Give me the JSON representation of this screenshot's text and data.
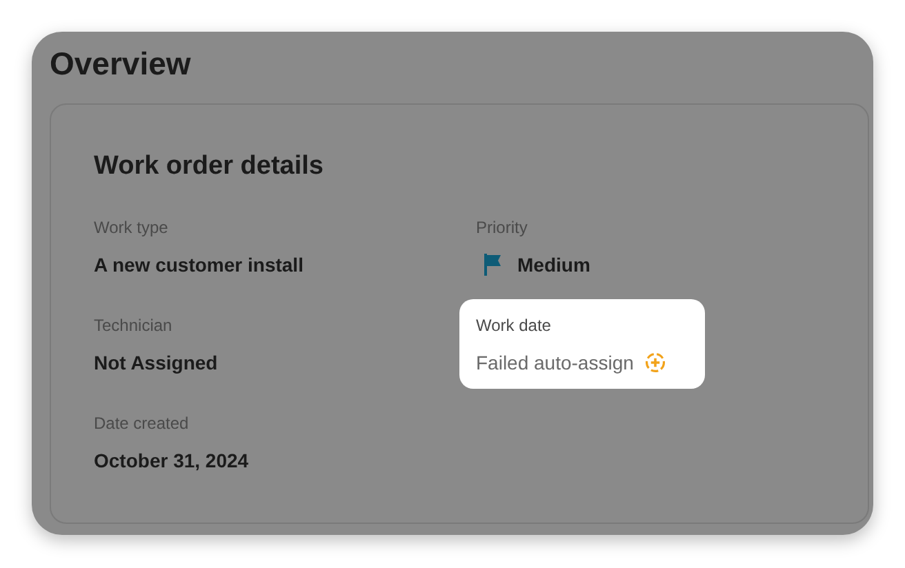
{
  "page": {
    "title": "Overview"
  },
  "card": {
    "title": "Work order details",
    "fields": [
      {
        "label": "Work type",
        "value": "A new customer install",
        "kind": "plain",
        "highlighted": false
      },
      {
        "label": "Priority",
        "value": "Medium",
        "kind": "flag",
        "highlighted": false
      },
      {
        "label": "Technician",
        "value": "Not Assigned",
        "kind": "plain",
        "highlighted": false
      },
      {
        "label": "Work date",
        "value": "Failed auto-assign",
        "kind": "warning",
        "highlighted": true
      },
      {
        "label": "Date created",
        "value": "October 31, 2024",
        "kind": "plain",
        "highlighted": false
      }
    ]
  }
}
